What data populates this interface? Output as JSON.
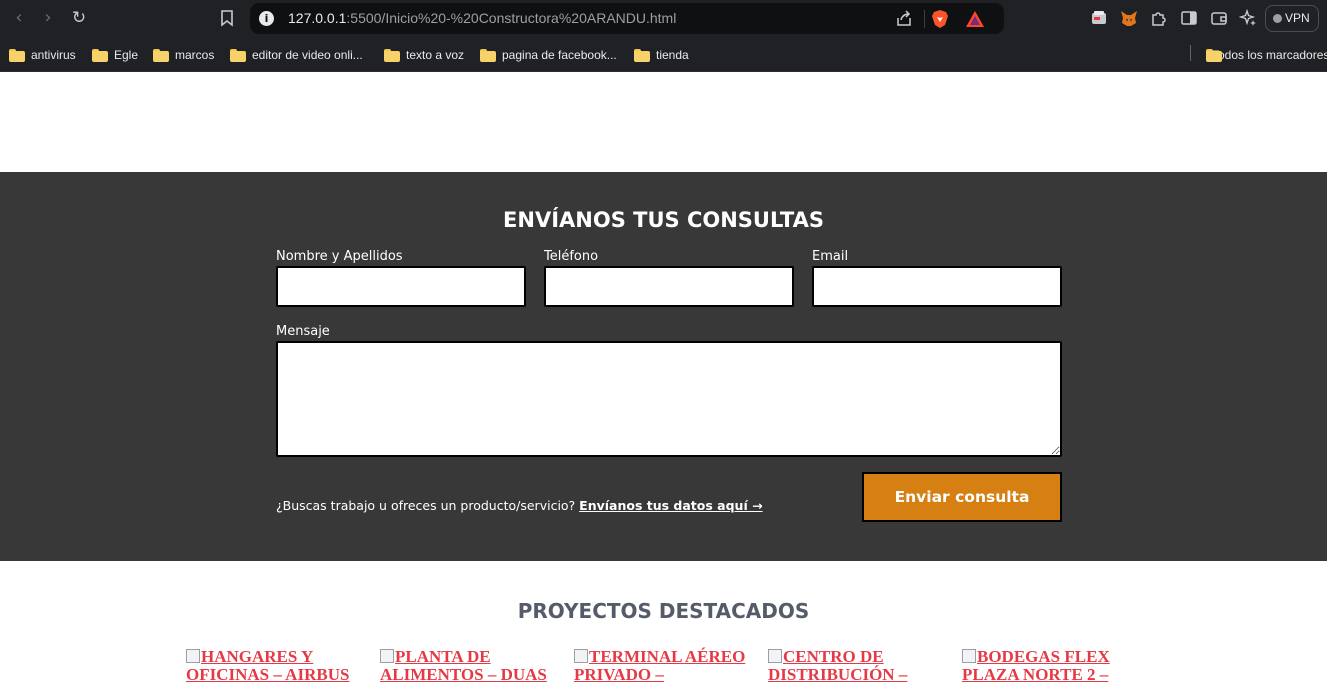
{
  "browser": {
    "url_host": "127.0.0.1",
    "url_rest": ":5500/Inicio%20-%20Constructora%20ARANDU.html",
    "vpn_label": "VPN",
    "bookmarks": [
      {
        "label": "antivirus"
      },
      {
        "label": "Egle"
      },
      {
        "label": "marcos"
      },
      {
        "label": "editor de video onli..."
      },
      {
        "label": "texto a voz"
      },
      {
        "label": "pagina de facebook..."
      },
      {
        "label": "tienda"
      }
    ],
    "all_bookmarks_label": "Todos los marcadores"
  },
  "contact": {
    "title": "ENVÍANOS TUS CONSULTAS",
    "name_label": "Nombre y Apellidos",
    "phone_label": "Teléfono",
    "email_label": "Email",
    "message_label": "Mensaje",
    "name_value": "",
    "phone_value": "",
    "email_value": "",
    "message_value": "",
    "note_text": "¿Buscas trabajo u ofreces un producto/servicio? ",
    "note_link": "Envíanos tus datos aquí →",
    "submit_label": "Enviar consulta"
  },
  "projects": {
    "title": "PROYECTOS DESTACADOS",
    "items": [
      {
        "alt": "HANGARES Y OFICINAS – AIRBUS"
      },
      {
        "alt": "PLANTA DE ALIMENTOS – DUAS"
      },
      {
        "alt": "TERMINAL AÉREO PRIVADO –"
      },
      {
        "alt": "CENTRO DE DISTRIBUCIÓN –"
      },
      {
        "alt": "BODEGAS FLEX PLAZA NORTE 2 –"
      }
    ]
  },
  "colors": {
    "section_bg": "#383838",
    "button_bg": "#d67f12",
    "projects_title": "#555b68",
    "project_link": "#e63946"
  }
}
